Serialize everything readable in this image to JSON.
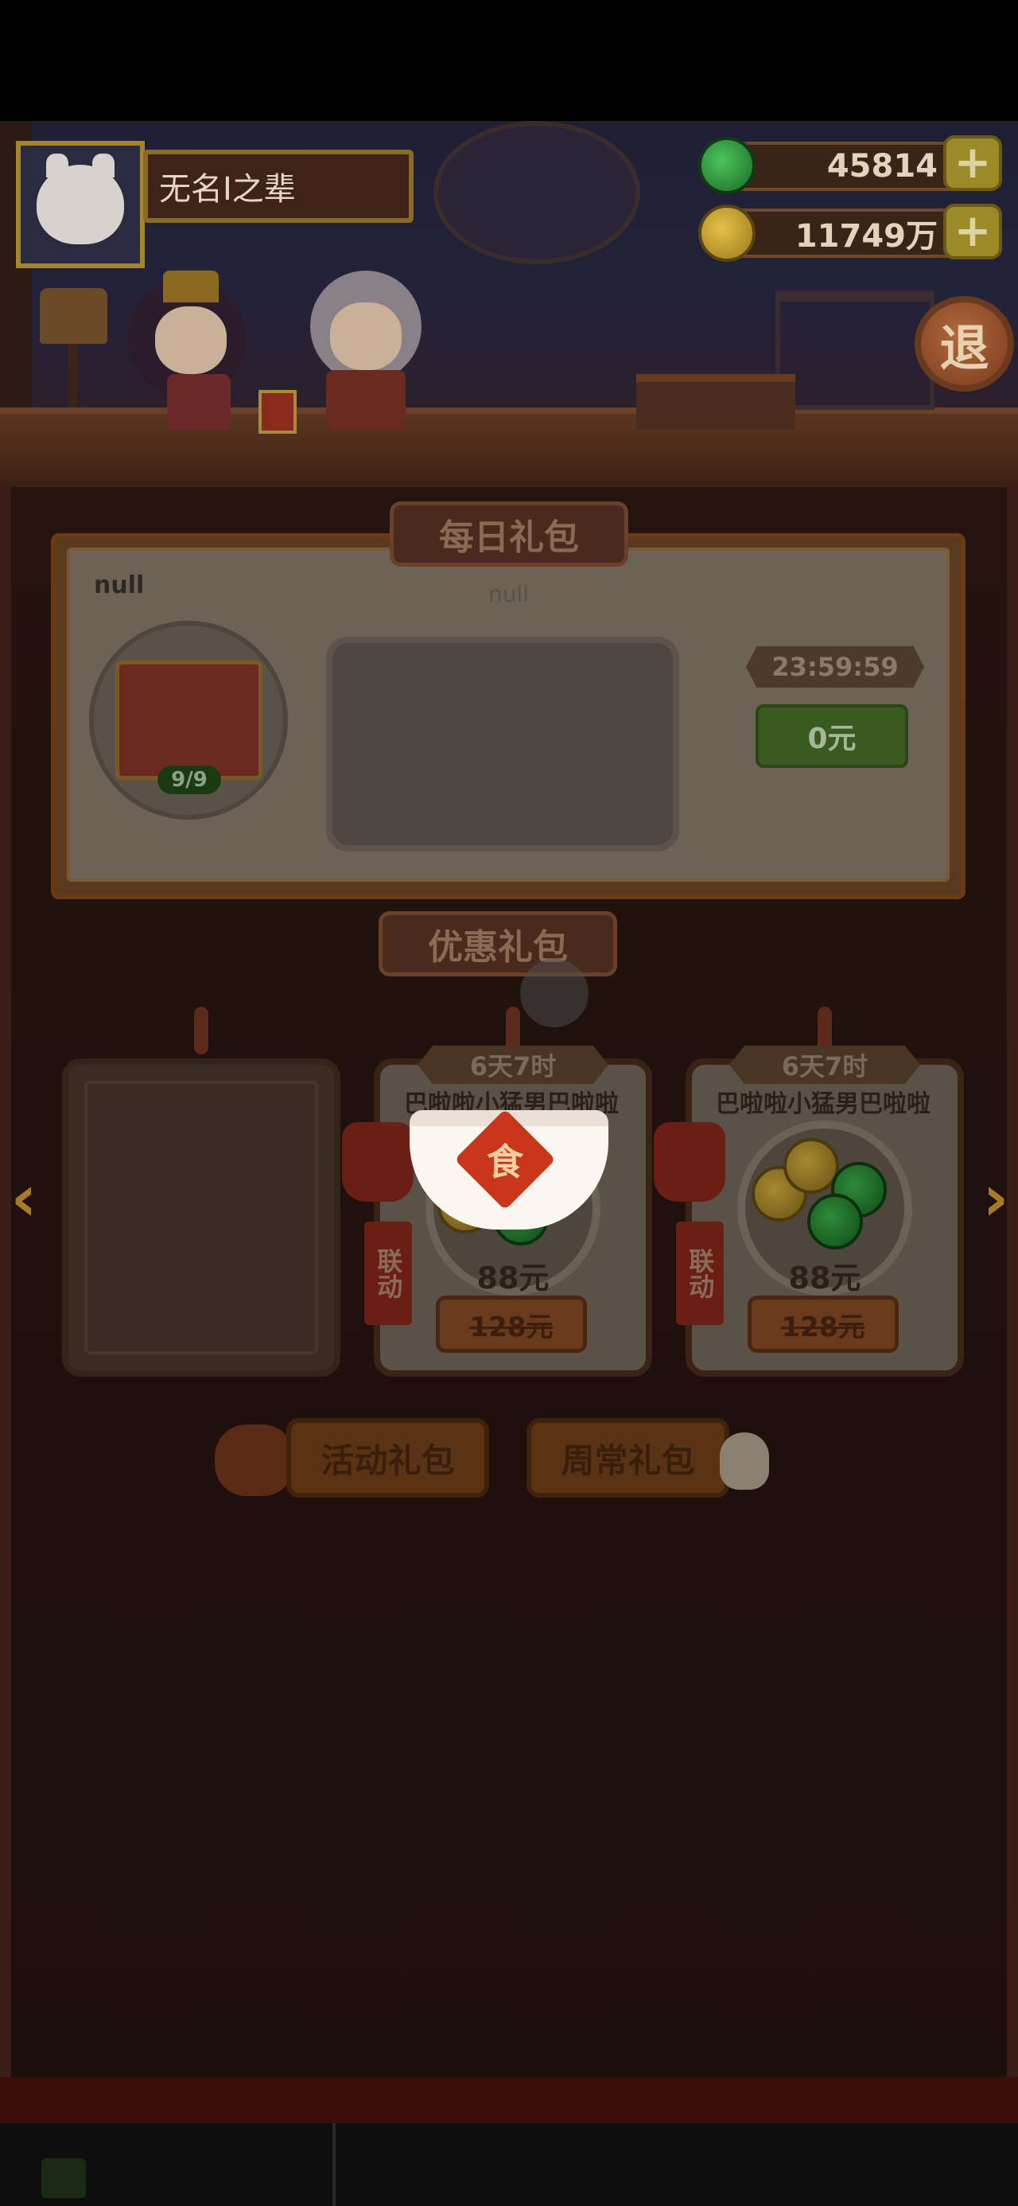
{
  "player": {
    "name": "无名I之辈"
  },
  "currency": {
    "jade": "45814",
    "coins": "11749万"
  },
  "header": {
    "exit_label": "退"
  },
  "daily_pack": {
    "section_title": "每日礼包",
    "left_null": "null",
    "center_null": "null",
    "item_count": "9/9",
    "timer": "23:59:59",
    "buy_label": "0元"
  },
  "discount_pack": {
    "section_title": "优惠礼包",
    "packs": [
      {
        "time_left": "6天7时",
        "name": "巴啦啦小猛男巴啦啦",
        "collab_label": "联动",
        "price": "88元",
        "original_price": "128元"
      },
      {
        "time_left": "6天7时",
        "name": "巴啦啦小猛男巴啦啦",
        "collab_label": "联动",
        "price": "88元",
        "original_price": "128元"
      }
    ]
  },
  "overlay": {
    "bowl_char": "食"
  },
  "tabs": {
    "activity_label": "活动礼包",
    "weekly_label": "周常礼包"
  },
  "colors": {
    "gold": "#a5852a",
    "buy_green": "#3a5a20",
    "bowl_stamp": "#c9361a"
  }
}
